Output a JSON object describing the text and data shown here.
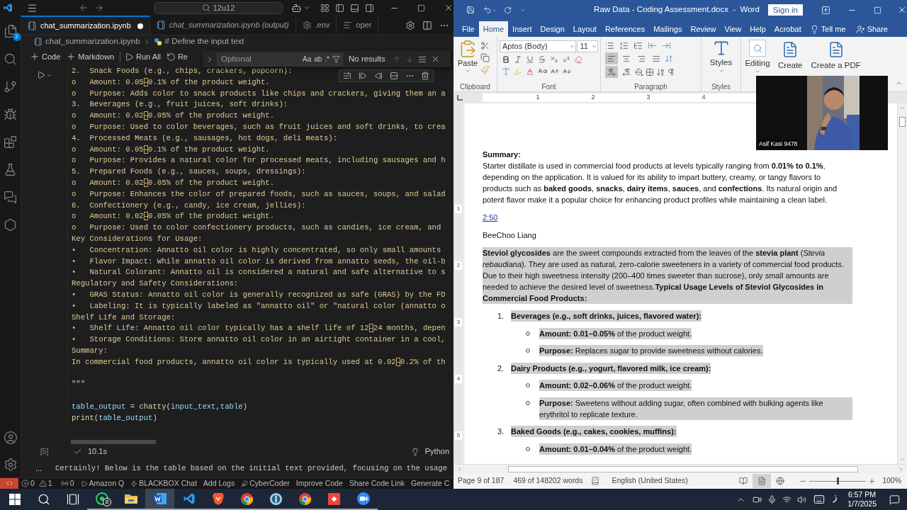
{
  "vscode": {
    "search": "12u12",
    "explorer_badge": "2",
    "tabs": [
      {
        "label": "chat_summarization.ipynb",
        "selected": true,
        "modified": true,
        "preview": false
      },
      {
        "label": "chat_summarization.ipynb (output)",
        "selected": false,
        "modified": false,
        "preview": true
      },
      {
        "label": ".env",
        "selected": false,
        "modified": false,
        "preview": false
      },
      {
        "label": "oper",
        "selected": false,
        "modified": false,
        "preview": false
      }
    ],
    "breadcrumb": [
      "chat_summarization.ipynb",
      "# Define the input text"
    ],
    "toolbar": [
      "Code",
      "Markdown",
      "Run All",
      "Re"
    ],
    "find": {
      "placeholder": "Optional",
      "options": [
        "Aa",
        "ab",
        ".*"
      ],
      "status": "No results"
    },
    "cell": {
      "lines": [
        {
          "segments": [
            {
              "text": "2.  Snack Foods (e.g., chips, crackers, popcorn):",
              "kind": "str"
            }
          ]
        },
        {
          "segments": [
            {
              "text": "o   Amount: 0.05",
              "kind": "str"
            },
            {
              "text": "–",
              "kind": "amb"
            },
            {
              "text": "0.1% of the product weight.",
              "kind": "str"
            }
          ]
        },
        {
          "segments": [
            {
              "text": "o   Purpose: Adds color to snack products like chips and crackers, giving them an a",
              "kind": "str"
            }
          ]
        },
        {
          "segments": [
            {
              "text": "3.  Beverages (e.g., fruit juices, soft drinks):",
              "kind": "str"
            }
          ]
        },
        {
          "segments": [
            {
              "text": "o   Amount: 0.02",
              "kind": "str"
            },
            {
              "text": "–",
              "kind": "amb"
            },
            {
              "text": "0.05% of the product weight.",
              "kind": "str"
            }
          ]
        },
        {
          "segments": [
            {
              "text": "o   Purpose: Used to color beverages, such as fruit juices and soft drinks, to crea",
              "kind": "str"
            }
          ]
        },
        {
          "segments": [
            {
              "text": "4.  Processed Meats (e.g., sausages, hot dogs, deli meats):",
              "kind": "str"
            }
          ]
        },
        {
          "segments": [
            {
              "text": "o   Amount: 0.05",
              "kind": "str"
            },
            {
              "text": "–",
              "kind": "amb"
            },
            {
              "text": "0.1% of the product weight.",
              "kind": "str"
            }
          ]
        },
        {
          "segments": [
            {
              "text": "o   Purpose: Provides a natural color for processed meats, including sausages and h",
              "kind": "str"
            }
          ]
        },
        {
          "segments": [
            {
              "text": "5.  Prepared Foods (e.g., sauces, soups, dressings):",
              "kind": "str"
            }
          ]
        },
        {
          "segments": [
            {
              "text": "o   Amount: 0.02",
              "kind": "str"
            },
            {
              "text": "–",
              "kind": "amb"
            },
            {
              "text": "0.05% of the product weight.",
              "kind": "str"
            }
          ]
        },
        {
          "segments": [
            {
              "text": "o   Purpose: Enhances the color of prepared foods, such as sauces, soups, and salad",
              "kind": "str"
            }
          ]
        },
        {
          "segments": [
            {
              "text": "6.  Confectionery (e.g., candy, ice cream, jellies):",
              "kind": "str"
            }
          ]
        },
        {
          "segments": [
            {
              "text": "o   Amount: 0.02",
              "kind": "str"
            },
            {
              "text": "–",
              "kind": "amb"
            },
            {
              "text": "0.05% of the product weight.",
              "kind": "str"
            }
          ]
        },
        {
          "segments": [
            {
              "text": "o   Purpose: Used to color confectionery products, such as candies, ice cream, and",
              "kind": "str"
            }
          ]
        },
        {
          "segments": [
            {
              "text": "Key Considerations for Usage:",
              "kind": "str"
            }
          ]
        },
        {
          "segments": [
            {
              "text": "•   Concentration: Annatto oil color is highly concentrated, so only small amounts",
              "kind": "str"
            }
          ]
        },
        {
          "segments": [
            {
              "text": "•   Flavor Impact: While annatto oil color is derived from annatto seeds, the oil-b",
              "kind": "str"
            }
          ]
        },
        {
          "segments": [
            {
              "text": "•   Natural Colorant: Annatto oil is considered a natural and safe alternative to s",
              "kind": "str"
            }
          ]
        },
        {
          "segments": [
            {
              "text": "Regulatory and Safety Considerations:",
              "kind": "str"
            }
          ]
        },
        {
          "segments": [
            {
              "text": "•   GRAS Status: Annatto oil color is generally recognized as safe (GRAS) by the FD",
              "kind": "str"
            }
          ]
        },
        {
          "segments": [
            {
              "text": "•   Labeling: It is typically labeled as \"annatto oil\" or \"natural color (annatto o",
              "kind": "str"
            }
          ]
        },
        {
          "segments": [
            {
              "text": "Shelf Life and Storage:",
              "kind": "str"
            }
          ]
        },
        {
          "segments": [
            {
              "text": "•   Shelf Life: Annatto oil color typically has a shelf life of 12",
              "kind": "str"
            },
            {
              "text": "–",
              "kind": "amb"
            },
            {
              "text": "24 months, depen",
              "kind": "str"
            }
          ]
        },
        {
          "segments": [
            {
              "text": "•   Storage Conditions: Store annatto oil color in an airtight container in a cool,",
              "kind": "str"
            }
          ]
        },
        {
          "segments": [
            {
              "text": "Summary:",
              "kind": "str"
            }
          ]
        },
        {
          "segments": [
            {
              "text": "In commercial food products, annatto oil color is typically used at 0.02",
              "kind": "str"
            },
            {
              "text": "–",
              "kind": "amb"
            },
            {
              "text": "0.2% of th",
              "kind": "str"
            }
          ]
        },
        {
          "space_before": true,
          "segments": [
            {
              "text": "\"\"\"",
              "kind": "str"
            }
          ]
        },
        {
          "space_before": true,
          "segments": [
            {
              "text": "table_output",
              "kind": "var"
            },
            {
              "text": " = ",
              "kind": "op"
            },
            {
              "text": "chatty",
              "kind": "fn"
            },
            {
              "text": "(",
              "kind": "op"
            },
            {
              "text": "input_text",
              "kind": "var"
            },
            {
              "text": ",",
              "kind": "op"
            },
            {
              "text": "table",
              "kind": "var"
            },
            {
              "text": ")",
              "kind": "op"
            }
          ]
        },
        {
          "segments": [
            {
              "text": "print",
              "kind": "fn"
            },
            {
              "text": "(",
              "kind": "op"
            },
            {
              "text": "table_output",
              "kind": "var"
            },
            {
              "text": ")",
              "kind": "op"
            }
          ]
        }
      ],
      "exec_count": "[5]",
      "succeeded": true,
      "duration": "10.1s",
      "language": "Python"
    },
    "output": {
      "more": "...",
      "text": "Certainly! Below is the table based on the initial text provided, focusing on the usage"
    },
    "status_bar": {
      "errors": "0",
      "warnings": "1",
      "ports": "0",
      "items": [
        "Amazon Q",
        "BLACKBOX Chat",
        "Add Logs",
        "CyberCoder",
        "Improve Code",
        "Share Code Link",
        "Generate C"
      ]
    }
  },
  "word": {
    "title": "Raw Data - Coding Assessment.docx  -  Word",
    "sign_in": "Sign in",
    "tabs": [
      {
        "label": "File",
        "selected": false
      },
      {
        "label": "Home",
        "selected": true
      },
      {
        "label": "Insert",
        "selected": false
      },
      {
        "label": "Design",
        "selected": false
      },
      {
        "label": "Layout",
        "selected": false
      },
      {
        "label": "References",
        "selected": false
      },
      {
        "label": "Mailings",
        "selected": false
      },
      {
        "label": "Review",
        "selected": false
      },
      {
        "label": "View",
        "selected": false
      },
      {
        "label": "Help",
        "selected": false
      },
      {
        "label": "Acrobat",
        "selected": false
      }
    ],
    "tell_me": "Tell me",
    "share": "Share",
    "ribbon": {
      "paste": "Paste",
      "font": "Aptos (Body)",
      "size": "11",
      "paragraph_tools": [
        {
          "kind": "align-left",
          "pressed": true
        },
        {
          "kind": "align-center",
          "pressed": false
        },
        {
          "kind": "align-right",
          "pressed": false
        },
        {
          "kind": "justify",
          "pressed": false
        }
      ],
      "direction_tools": [
        {
          "kind": "ltr",
          "pressed": true
        },
        {
          "kind": "rtl",
          "pressed": false
        }
      ],
      "styles": "Styles",
      "editing": "Editing",
      "pdf_buttons": [
        "Create",
        "Create a PDF"
      ],
      "groups": [
        "Clipboard",
        "Font",
        "Paragraph",
        "Styles"
      ]
    },
    "ruler": [
      "1",
      "2",
      "3",
      "4"
    ],
    "vertical_ruler": [
      "1",
      "2",
      "3",
      "4",
      "5"
    ],
    "webcam": {
      "name": "Asif Kasi 9478"
    },
    "document": [
      {
        "kind": "heading",
        "text": "Summary:",
        "selected": false
      },
      {
        "kind": "para",
        "text": "Starter distillate is used in commercial food products at levels typically ranging from **0.01% to 0.1%**, depending on the application. It is valued for its ability to impart buttery, creamy, or tangy flavors to products such as **baked goods**, **snacks**, **dairy items**, **sauces**, and **confections**. Its natural origin and potent flavor make it a popular choice for enhancing product profiles while maintaining a clean label.",
        "selected": false
      },
      {
        "kind": "link",
        "text": "2:50",
        "selected": false
      },
      {
        "kind": "para",
        "text": "BeeChoo Liang",
        "selected": false
      },
      {
        "kind": "para",
        "text": "**Steviol glycosides** are the sweet compounds extracted from the leaves of the **stevia plant** (*Stevia rebaudiana*). They are used as natural, zero-calorie sweeteners in a variety of commercial food products. Due to their high sweetness intensity (200–400 times sweeter than sucrose), only small amounts are needed to achieve the desired level of sweetness.**Typical Usage Levels of Steviol Glycosides in Commercial Food Products:**",
        "selected": true
      },
      {
        "kind": "item",
        "number": "1.",
        "text": "Beverages (e.g., soft drinks, juices, flavored water):",
        "selected": true,
        "children": [
          {
            "text": "**Amount: 0.01–0.05%** of the product weight.",
            "selected": true
          },
          {
            "text": "**Purpose:** Replaces sugar to provide sweetness without calories.",
            "selected": true
          }
        ]
      },
      {
        "kind": "item",
        "number": "2.",
        "text": "Dairy Products (e.g., yogurt, flavored milk, ice cream):",
        "selected": true,
        "children": [
          {
            "text": "**Amount: 0.02–0.06%** of the product weight.",
            "selected": true
          },
          {
            "text": "**Purpose:** Sweetens without adding sugar, often combined with bulking agents like erythritol to replicate texture.",
            "selected": true
          }
        ]
      },
      {
        "kind": "item",
        "number": "3.",
        "text": "Baked Goods (e.g., cakes, cookies, muffins):",
        "selected": true,
        "children": [
          {
            "text": "**Amount: 0.01–0.04%** of the product weight.",
            "selected": true
          }
        ]
      }
    ],
    "status_bar": {
      "page": "Page 9 of 187",
      "words": "469 of 148202 words",
      "language": "English (United States)",
      "views": [
        {
          "kind": "read",
          "selected": false
        },
        {
          "kind": "print",
          "selected": true
        },
        {
          "kind": "web",
          "selected": false
        }
      ],
      "zoom": {
        "level": 0.5,
        "reading": "100%"
      }
    }
  },
  "taskbar": {
    "apps": [
      {
        "kind": "start",
        "active": false,
        "running": false
      },
      {
        "kind": "search",
        "active": false,
        "running": false
      },
      {
        "kind": "task-view",
        "active": false,
        "running": false
      },
      {
        "kind": "whatsapp",
        "badge": "8",
        "active": false,
        "running": true
      },
      {
        "kind": "explorer",
        "active": false,
        "running": true
      },
      {
        "kind": "word",
        "active": true,
        "running": true
      },
      {
        "kind": "vscode",
        "active": false,
        "running": true
      },
      {
        "kind": "brave",
        "active": false,
        "running": true
      },
      {
        "kind": "chrome",
        "active": false,
        "running": true
      },
      {
        "kind": "teal-app",
        "active": false,
        "running": true
      },
      {
        "kind": "chrome",
        "active": false,
        "running": true
      },
      {
        "kind": "red-app",
        "active": false,
        "running": true
      },
      {
        "kind": "zoom",
        "active": false,
        "running": true
      }
    ],
    "time": "6:57 PM",
    "date": "1/7/2025"
  }
}
